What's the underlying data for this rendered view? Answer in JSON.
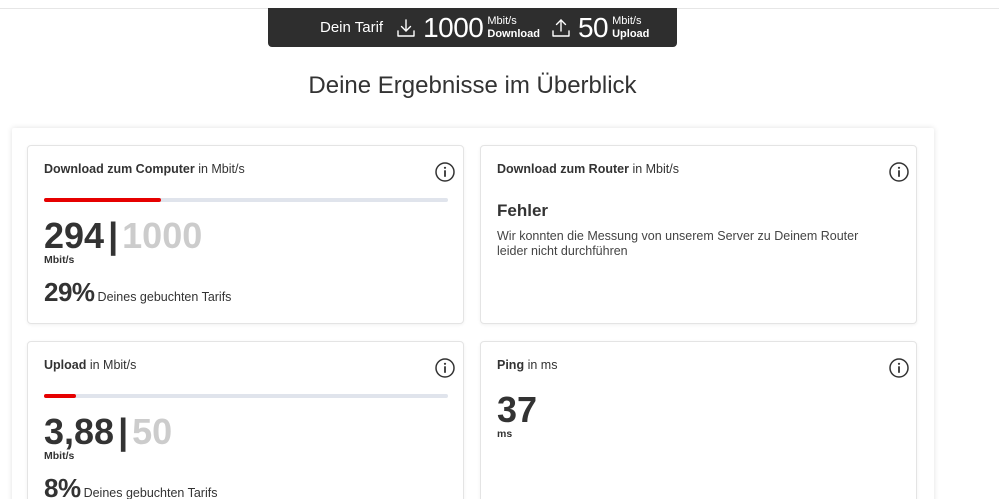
{
  "tariff": {
    "label": "Dein Tarif",
    "download_value": "1000",
    "download_unit": "Mbit/s",
    "download_label": "Download",
    "upload_value": "50",
    "upload_unit": "Mbit/s",
    "upload_label": "Upload",
    "download_icon": "download-icon",
    "upload_icon": "upload-icon"
  },
  "page_title": "Deine Ergebnisse im Überblick",
  "cards": {
    "download_computer": {
      "title_strong": "Download zum Computer",
      "title_unit": "in Mbit/s",
      "value": "294",
      "separator": "|",
      "max": "1000",
      "unit": "Mbit/s",
      "percent": "29%",
      "percent_text": "Deines gebuchten Tarifs",
      "progress": 0.29
    },
    "download_router": {
      "title_strong": "Download zum Router",
      "title_unit": "in Mbit/s",
      "error_title": "Fehler",
      "error_text": "Wir konnten die Messung von unserem Server zu Deinem Router leider nicht durchführen"
    },
    "upload": {
      "title_strong": "Upload",
      "title_unit": "in Mbit/s",
      "value": "3,88",
      "separator": "|",
      "max": "50",
      "unit": "Mbit/s",
      "percent": "8%",
      "percent_text": "Deines gebuchten Tarifs",
      "progress": 0.08
    },
    "ping": {
      "title_strong": "Ping",
      "title_unit": "in ms",
      "value": "37",
      "unit": "ms"
    }
  },
  "colors": {
    "accent": "#e60000",
    "track": "#e0e4ec",
    "tariff_bg": "#2e2e2e",
    "muted_value": "#cccccc"
  }
}
